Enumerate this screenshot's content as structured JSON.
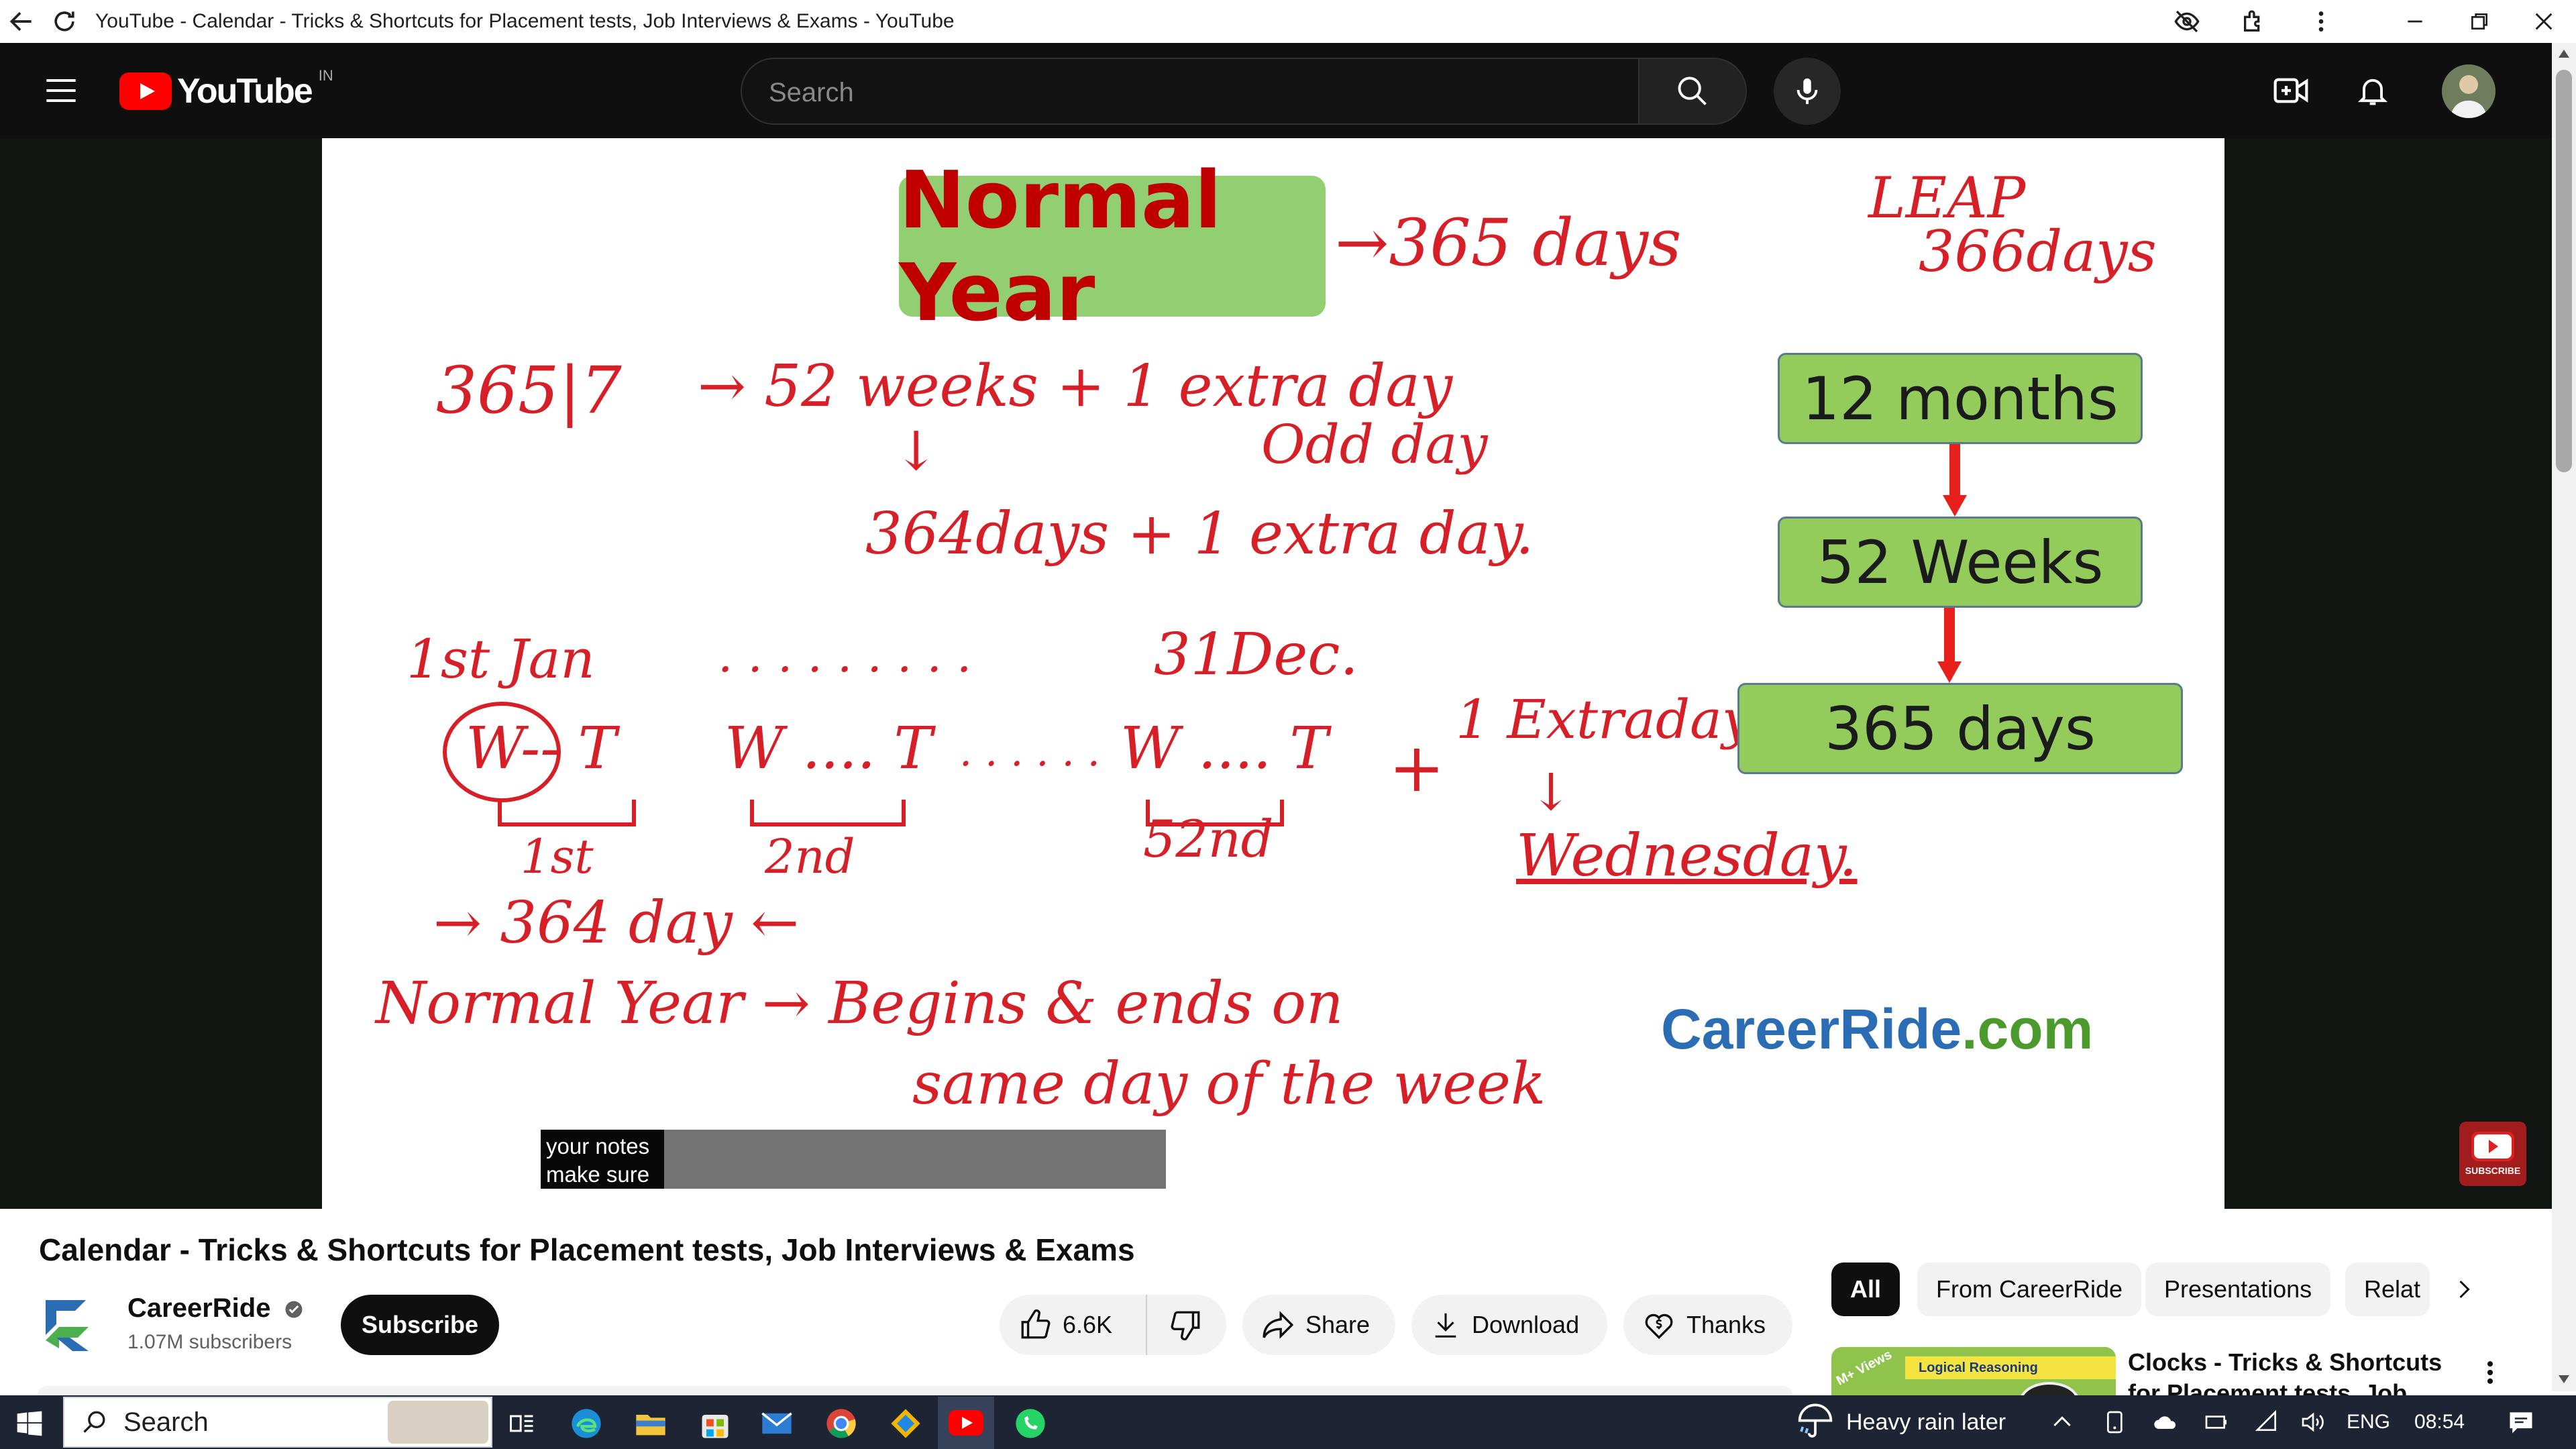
{
  "window": {
    "title": "YouTube - Calendar - Tricks & Shortcuts for Placement tests, Job Interviews & Exams - YouTube"
  },
  "header": {
    "logo_text": "YouTube",
    "region": "IN",
    "search_placeholder": "Search"
  },
  "slide": {
    "title": "Normal Year",
    "arrow_note": "→365 days",
    "leap_line1": "LEAP",
    "leap_line2": "366days",
    "division": "365|7",
    "weeks_line": "→ 52 weeks + 1 extra day",
    "odd_day": "Odd day",
    "days_line": "364days + 1 extra day.",
    "jan": "1st Jan",
    "dots1": ". . . . . . . . .",
    "dec": "31Dec.",
    "w1": "W-- T",
    "w2": "W .... T",
    "dots2": ". . . . . .",
    "w52": "W .... T",
    "plus": "+",
    "extra_day": "1 Extraday",
    "wednesday": "Wednesday.",
    "week1": "1st",
    "week2": "2nd",
    "week52": "52nd",
    "day364": "→ 364 day ←",
    "normal_year_note": "Normal Year → Begins & ends on",
    "same_day": "same day of the week",
    "box_months": "12 months",
    "box_weeks": "52 Weeks",
    "box_days": "365 days",
    "brand": "CareerRide",
    "brand_suffix": ".com",
    "subscribe_badge": "SUBSCRIBE"
  },
  "subtitle": {
    "line1": "your notes",
    "line2": "make sure"
  },
  "video": {
    "title": "Calendar - Tricks & Shortcuts for Placement tests, Job Interviews & Exams",
    "channel": "CareerRide",
    "subscribers": "1.07M subscribers",
    "subscribe_label": "Subscribe",
    "likes": "6.6K",
    "share_label": "Share",
    "download_label": "Download",
    "thanks_label": "Thanks"
  },
  "chips": [
    "All",
    "From CareerRide",
    "Presentations",
    "Relat"
  ],
  "recommendation": {
    "thumb_label": "Logical Reasoning",
    "thumb_badge": "M+ Views",
    "title": "Clocks - Tricks & Shortcuts for Placement tests, Job Intervie..."
  },
  "taskbar": {
    "search_label": "Search",
    "weather": "Heavy rain later",
    "lang": "ENG",
    "time": "08:54"
  },
  "colors": {
    "accent_red": "#ff0000",
    "ink_red": "#d61f27",
    "box_green": "#93cc5b",
    "brand_blue": "#2a6db5"
  }
}
